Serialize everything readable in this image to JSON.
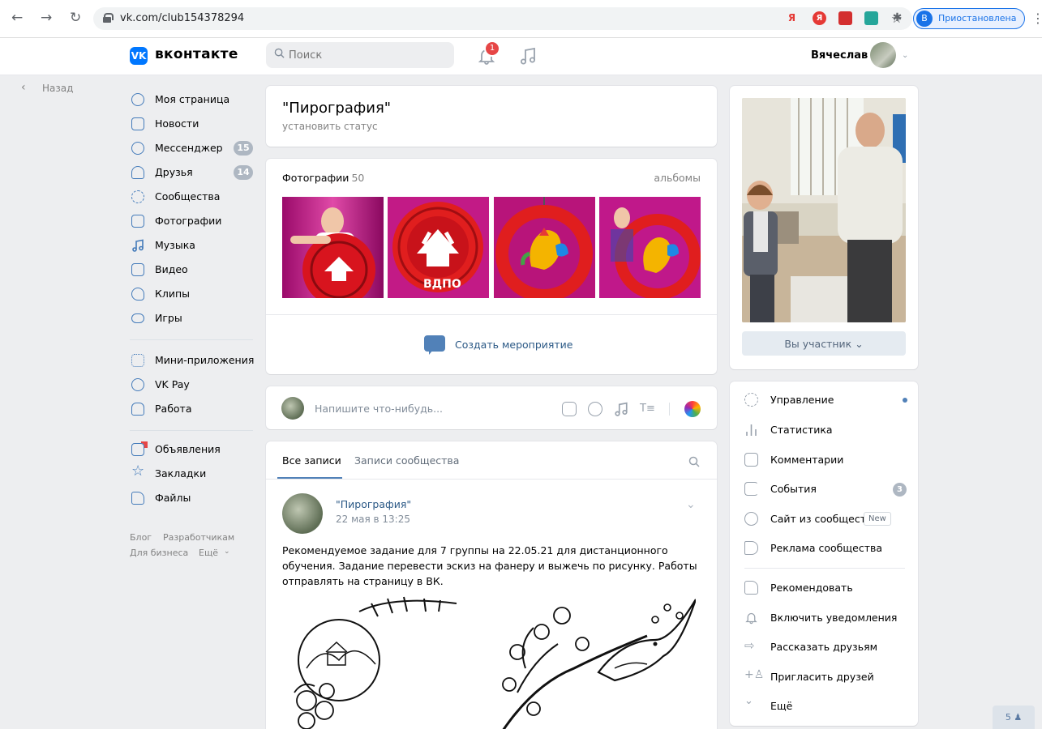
{
  "browser": {
    "url": "vk.com/club154378294",
    "profile_initial": "В",
    "profile_status": "Приостановлена",
    "ext_letters": [
      "Я",
      "Я",
      "",
      ""
    ]
  },
  "header": {
    "brand": "вконтакте",
    "search_placeholder": "Поиск",
    "notifications_count": "1",
    "user_name": "Вячеслав"
  },
  "back_label": "Назад",
  "sidebar": {
    "items": [
      {
        "label": "Моя страница",
        "icon": "user-circle-icon"
      },
      {
        "label": "Новости",
        "icon": "news-icon"
      },
      {
        "label": "Мессенджер",
        "icon": "chat-bubble-icon",
        "count": "15"
      },
      {
        "label": "Друзья",
        "icon": "friends-icon",
        "count": "14"
      },
      {
        "label": "Сообщества",
        "icon": "communities-icon"
      },
      {
        "label": "Фотографии",
        "icon": "photos-icon"
      },
      {
        "label": "Музыка",
        "icon": "music-note-icon"
      },
      {
        "label": "Видео",
        "icon": "video-icon"
      },
      {
        "label": "Клипы",
        "icon": "clips-icon"
      },
      {
        "label": "Игры",
        "icon": "gamepad-icon"
      }
    ],
    "items2": [
      {
        "label": "Мини-приложения",
        "icon": "apps-icon"
      },
      {
        "label": "VK Pay",
        "icon": "vkpay-icon"
      },
      {
        "label": "Работа",
        "icon": "briefcase-icon"
      }
    ],
    "items3": [
      {
        "label": "Объявления",
        "icon": "ads-icon"
      },
      {
        "label": "Закладки",
        "icon": "star-icon"
      },
      {
        "label": "Файлы",
        "icon": "file-icon"
      }
    ],
    "footer_links": [
      "Блог",
      "Разработчикам",
      "Для бизнеса",
      "Ещё"
    ]
  },
  "group": {
    "title": "\"Пирография\"",
    "status": "установить статус"
  },
  "photos": {
    "label": "Фотографии",
    "count": "50",
    "albums_link": "альбомы",
    "create_event": "Создать мероприятие"
  },
  "composer": {
    "placeholder": "Напишите что-нибудь..."
  },
  "wall": {
    "tabs": [
      "Все записи",
      "Записи сообщества"
    ],
    "post": {
      "author": "\"Пирография\"",
      "date": "22 мая в 13:25",
      "text": "Рекомендуемое задание для 7 группы на 22.05.21 для дистанционного обучения. Задание перевести эскиз на фанеру и выжечь по рисунку. Работы отправлять на страницу в ВК."
    }
  },
  "right": {
    "member_button": "Вы участник",
    "menu": [
      {
        "label": "Управление",
        "icon": "gear-icon",
        "dot": true
      },
      {
        "label": "Статистика",
        "icon": "stats-bars-icon"
      },
      {
        "label": "Комментарии",
        "icon": "comment-icon"
      },
      {
        "label": "События",
        "icon": "events-icon",
        "count": "3"
      },
      {
        "label": "Сайт из сообщества",
        "icon": "globe-icon",
        "badge": "New"
      },
      {
        "label": "Реклама сообщества",
        "icon": "megaphone-icon"
      }
    ],
    "menu2": [
      {
        "label": "Рекомендовать",
        "icon": "thumb-up-icon"
      },
      {
        "label": "Включить уведомления",
        "icon": "bell-icon"
      },
      {
        "label": "Рассказать друзьям",
        "icon": "share-arrow-icon"
      },
      {
        "label": "Пригласить друзей",
        "icon": "invite-user-icon"
      },
      {
        "label": "Ещё",
        "icon": "chevron-down-icon"
      }
    ]
  },
  "online_count": "5"
}
